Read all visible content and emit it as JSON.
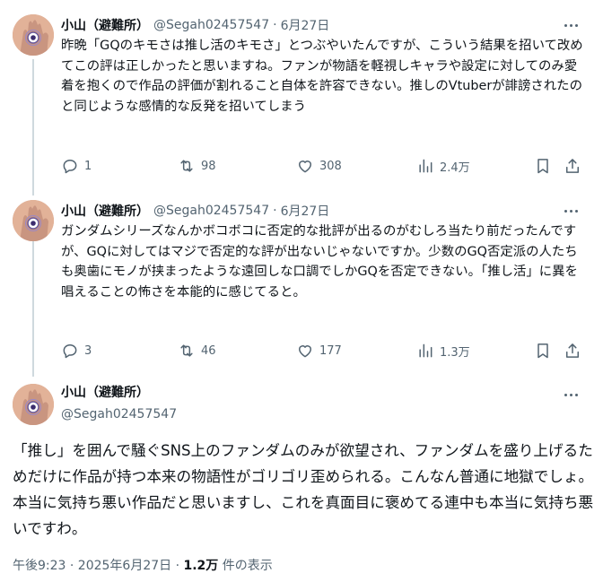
{
  "tweets": [
    {
      "name": "小山（避難所）",
      "handle": "@Segah02457547",
      "separator": "·",
      "date": "6月27日",
      "text": "昨晩「GQのキモさは推し活のキモさ」とつぶやいたんですが、こういう結果を招いて改めてこの評は正しかったと思いますね。ファンが物語を軽視しキャラや設定に対してのみ愛着を抱くので作品の評価が割れること自体を許容できない。推しのVtuberが誹謗されたのと同じような感情的な反発を招いてしまう",
      "replies": "1",
      "retweets": "98",
      "likes": "308",
      "views": "2.4万"
    },
    {
      "name": "小山（避難所）",
      "handle": "@Segah02457547",
      "separator": "·",
      "date": "6月27日",
      "text": "ガンダムシリーズなんかボコボコに否定的な批評が出るのがむしろ当たり前だったんですが、GQに対してはマジで否定的な評が出ないじゃないですか。少数のGQ否定派の人たちも奥歯にモノが挟まったような遠回しな口調でしかGQを否定できない。「推し活」に異を唱えることの怖さを本能的に感じてると。",
      "replies": "3",
      "retweets": "46",
      "likes": "177",
      "views": "1.3万"
    }
  ],
  "main": {
    "name": "小山（避難所）",
    "handle": "@Segah02457547",
    "text": "「推し」を囲んで騒ぐSNS上のファンダムのみが欲望され、ファンダムを盛り上げるためだけに作品が持つ本来の物語性がゴリゴリ歪められる。こんなん普通に地獄でしょ。本当に気持ち悪い作品だと思いますし、これを真面目に褒めてる連中も本当に気持ち悪いですわ。",
    "time": "午後9:23 · 2025年6月27日 · ",
    "views_count": "1.2万",
    "views_label": " 件の表示"
  },
  "icons": [
    "avatar-icon",
    "more-icon",
    "reply-icon",
    "retweet-icon",
    "like-icon",
    "views-icon",
    "bookmark-icon",
    "share-icon"
  ],
  "colors": {
    "text": "#0f1419",
    "secondary": "#536471",
    "thread_line": "#cfd9de"
  }
}
